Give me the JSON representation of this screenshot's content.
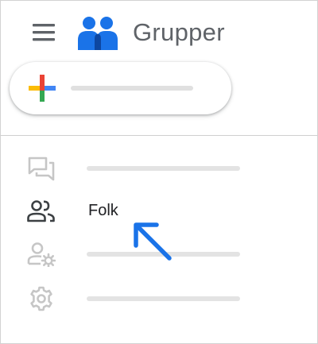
{
  "app": {
    "title": "Grupper",
    "menu_icon": "hamburger-menu-icon",
    "logo_icon": "groups-logo-icon"
  },
  "compose": {
    "icon": "colored-plus-icon",
    "colors": {
      "blue": "#4285F4",
      "red": "#EA4335",
      "yellow": "#FBBC05",
      "green": "#34A853"
    }
  },
  "nav": {
    "items": [
      {
        "icon": "conversations-icon",
        "label": ""
      },
      {
        "icon": "people-icon",
        "label": "Folk"
      },
      {
        "icon": "manage-members-icon",
        "label": ""
      },
      {
        "icon": "settings-gear-icon",
        "label": ""
      }
    ]
  },
  "annotation": {
    "icon": "pointer-arrow-icon",
    "color": "#1a73e8"
  },
  "colors": {
    "text_gray": "#5f6368",
    "faded_icon": "#c6c6c6",
    "dark_icon": "#3c4043",
    "logo_blue": "#1a73e8"
  }
}
